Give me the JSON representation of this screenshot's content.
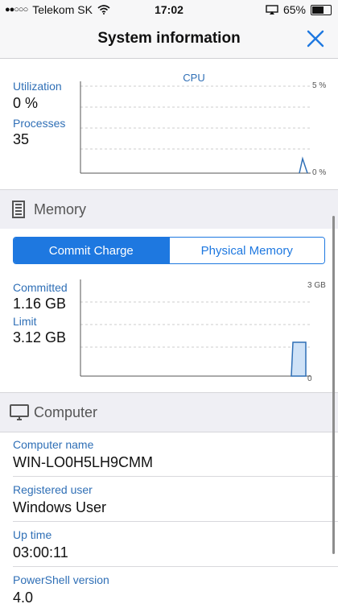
{
  "status": {
    "carrier": "Telekom SK",
    "time": "17:02",
    "battery": "65%",
    "battery_level": 0.65
  },
  "nav": {
    "title": "System information",
    "close_icon": "close-icon"
  },
  "cpu": {
    "chart_title": "CPU",
    "utilization_label": "Utilization",
    "utilization_value": "0 %",
    "processes_label": "Processes",
    "processes_value": "35",
    "y_max_label": "5 %",
    "y_min_label": "0 %"
  },
  "memory": {
    "header": "Memory",
    "icon": "memory-icon",
    "tabs": [
      "Commit Charge",
      "Physical Memory"
    ],
    "active_tab": 0,
    "committed_label": "Committed",
    "committed_value": "1.16 GB",
    "limit_label": "Limit",
    "limit_value": "3.12 GB",
    "y_max_label": "3 GB",
    "y_min_label": "0"
  },
  "computer": {
    "header": "Computer",
    "icon": "monitor-icon",
    "rows": [
      {
        "label": "Computer name",
        "value": "WIN-LO0H5LH9CMM"
      },
      {
        "label": "Registered user",
        "value": "Windows User"
      },
      {
        "label": "Up time",
        "value": "03:00:11"
      },
      {
        "label": "PowerShell version",
        "value": "4.0"
      }
    ]
  }
}
